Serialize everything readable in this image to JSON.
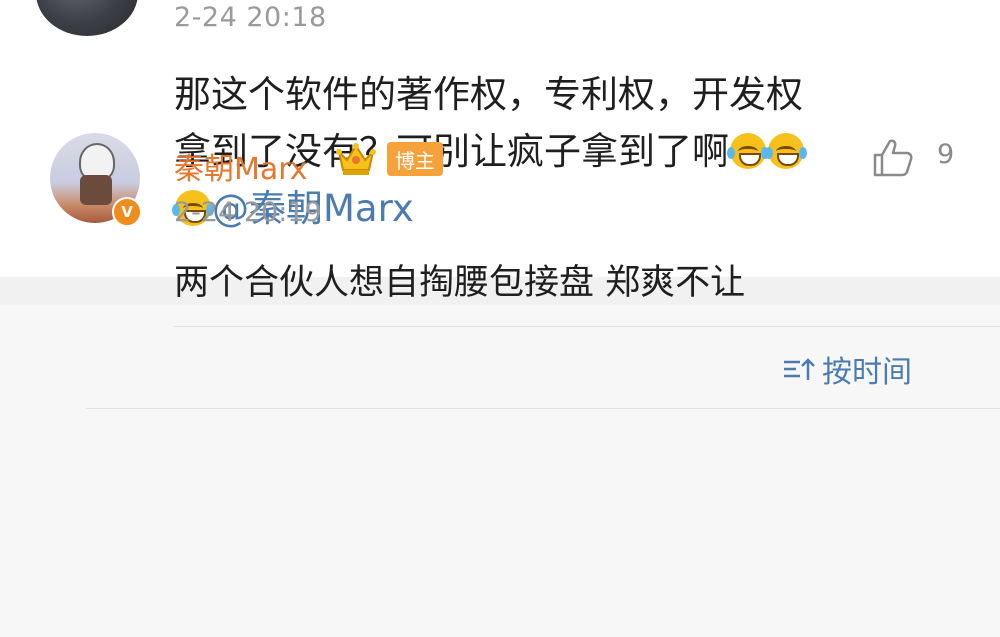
{
  "post": {
    "time": "2-24 20:18",
    "line1": "那这个软件的著作权，专利权，开发权",
    "line2": "拿到了没有？可别让疯子拿到了啊",
    "mention": "@秦朝Marx",
    "emoji_icon": "laugh-cry-emoji"
  },
  "sort": {
    "label": "按时间",
    "icon": "sort-icon"
  },
  "comment": {
    "author": "秦朝Marx",
    "role": "博主",
    "verified_badge": "V",
    "time": "2-24 20:19",
    "text": "两个合伙人想自掏腰包接盘 郑爽不让",
    "likes": "9",
    "crown_icon": "crown-icon",
    "like_icon": "thumbs-up-icon"
  },
  "colors": {
    "accent_blue": "#4a7cb0",
    "name_orange": "#e8772e",
    "badge_orange": "#f5a23a",
    "time_gray": "#9a9a9a",
    "band_gray": "#f1f1f1"
  }
}
